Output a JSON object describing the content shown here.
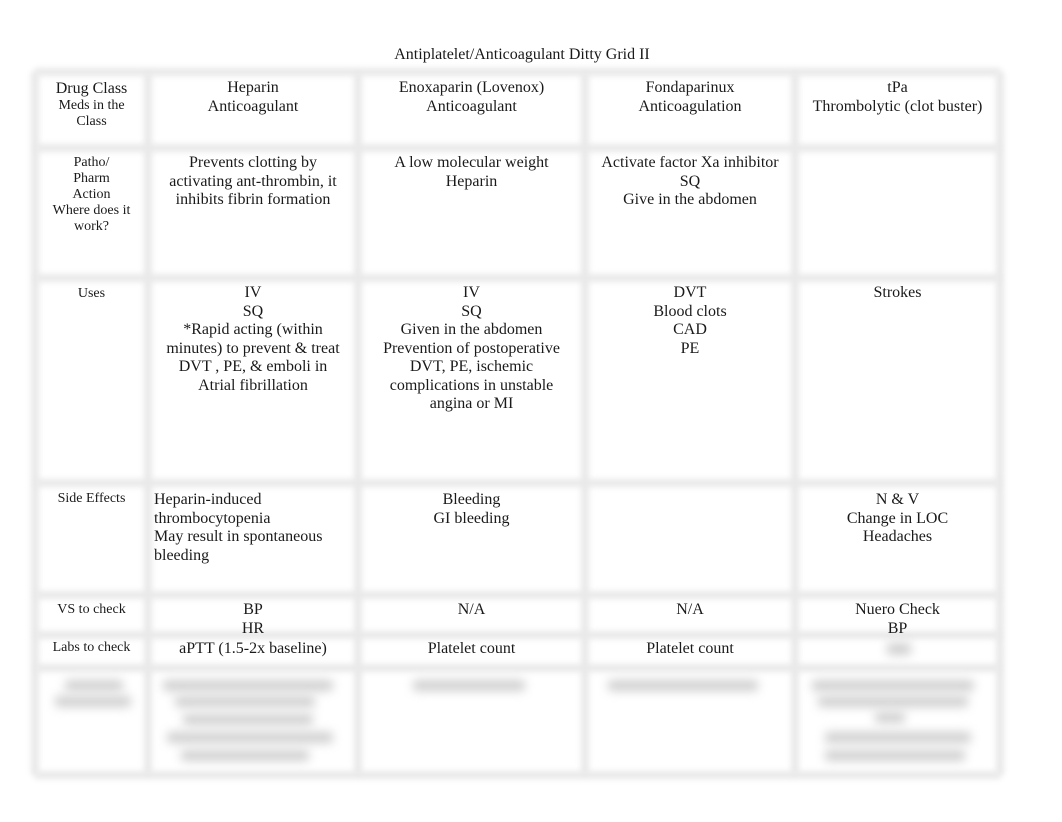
{
  "document": {
    "title": "Antiplatelet/Anticoagulant Ditty Grid II"
  },
  "grid": {
    "header": {
      "label_line1": "Drug Class",
      "label_line2": "Meds in the",
      "label_line3": "Class",
      "drugs": [
        {
          "name": "Heparin",
          "class": "Anticoagulant"
        },
        {
          "name": "Enoxaparin (Lovenox)",
          "class": "Anticoagulant"
        },
        {
          "name": "Fondaparinux",
          "class": "Anticoagulation"
        },
        {
          "name": "tPa",
          "class": "Thrombolytic (clot buster)"
        }
      ]
    },
    "rows": {
      "patho": {
        "label": [
          "Patho/",
          "Pharm",
          "Action",
          "Where does it",
          "work?"
        ],
        "cells": [
          [
            "Prevents clotting by",
            "activating ant-thrombin, it",
            "inhibits fibrin formation"
          ],
          [
            "A low molecular weight",
            "Heparin"
          ],
          [
            "Activate factor Xa inhibitor",
            "SQ",
            "Give in the abdomen"
          ],
          []
        ]
      },
      "uses": {
        "label": [
          "Uses"
        ],
        "cells": [
          [
            "IV",
            "SQ",
            "*Rapid acting (within",
            "minutes) to prevent & treat",
            "DVT , PE, & emboli in",
            "Atrial fibrillation"
          ],
          [
            "IV",
            "SQ",
            "Given in the abdomen",
            "Prevention of postoperative",
            "DVT, PE, ischemic",
            "complications in unstable",
            "angina or MI"
          ],
          [
            "DVT",
            "Blood clots",
            "CAD",
            "PE"
          ],
          [
            "Strokes"
          ]
        ]
      },
      "side_effects": {
        "label": [
          "Side Effects"
        ],
        "cells": [
          [
            "Heparin-induced",
            "thrombocytopenia",
            "May result in spontaneous",
            "bleeding"
          ],
          [
            "Bleeding",
            "GI bleeding"
          ],
          [],
          [
            "N & V",
            "Change in LOC",
            "Headaches"
          ]
        ]
      },
      "vs": {
        "label": [
          "VS to check"
        ],
        "cells": [
          [
            "BP",
            "HR"
          ],
          [
            "N/A"
          ],
          [
            "N/A"
          ],
          [
            "Nuero Check",
            "BP"
          ]
        ]
      },
      "labs": {
        "label": [
          "Labs to check"
        ],
        "cells": [
          [
            "aPTT (1.5-2x baseline)"
          ],
          [
            "Platelet count"
          ],
          [
            "Platelet count"
          ],
          []
        ]
      },
      "redacted": {
        "note": "blurred row — text not legible"
      }
    }
  }
}
